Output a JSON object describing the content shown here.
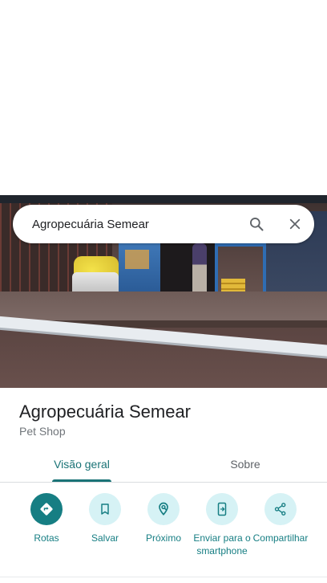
{
  "search": {
    "query": "Agropecuária Semear"
  },
  "place": {
    "name": "Agropecuária Semear",
    "category": "Pet Shop"
  },
  "tabs": [
    {
      "label": "Visão geral",
      "active": true
    },
    {
      "label": "Sobre",
      "active": false
    }
  ],
  "actions": [
    {
      "label": "Rotas",
      "icon": "directions-icon"
    },
    {
      "label": "Salvar",
      "icon": "bookmark-icon"
    },
    {
      "label": "Próximo",
      "icon": "nearby-icon"
    },
    {
      "label": "Enviar para o smartphone",
      "icon": "send-to-phone-icon"
    },
    {
      "label": "Compartilhar",
      "icon": "share-icon"
    }
  ],
  "colors": {
    "accent": "#167e83",
    "action_bg": "#d6f2f5",
    "secondary_text": "#70757a"
  }
}
